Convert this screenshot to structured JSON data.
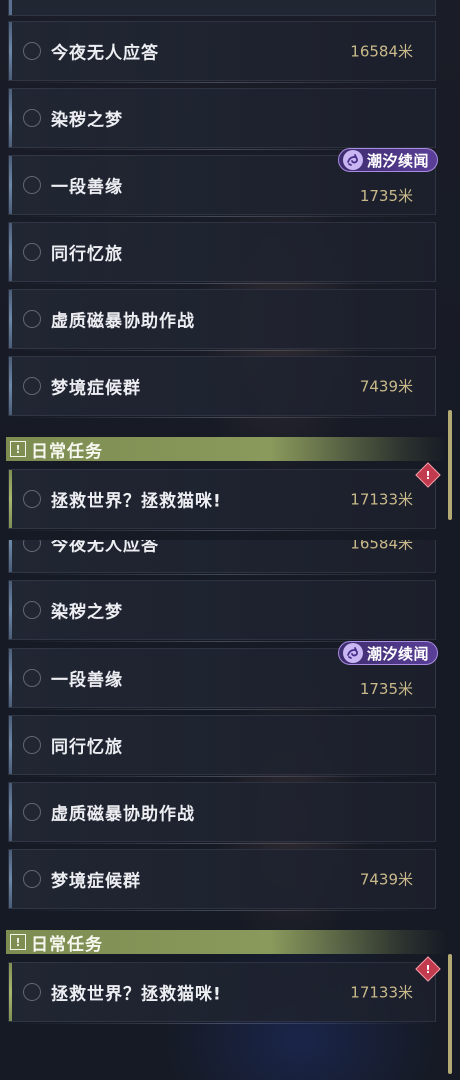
{
  "quests": [
    {
      "name": "今夜无人应答",
      "distance": "16584米"
    },
    {
      "name": "染秽之梦",
      "distance": ""
    },
    {
      "name": "一段善缘",
      "distance": "1735米",
      "badge": "潮汐续闻"
    },
    {
      "name": "同行忆旅",
      "distance": ""
    },
    {
      "name": "虚质磁暴协助作战",
      "distance": ""
    },
    {
      "name": "梦境症候群",
      "distance": "7439米"
    }
  ],
  "daily_section": {
    "title": "日常任务",
    "icon": "exclamation-square-icon"
  },
  "daily_quest": {
    "name": "拯救世界？拯救猫咪!",
    "distance": "17133米",
    "alert_icon": "alert-diamond-icon"
  },
  "badge_icon": "swirl-icon",
  "colors": {
    "accent_green": "#8a9a5c",
    "badge_purple": "#5a3f98",
    "distance_gold": "#c9b98a"
  }
}
